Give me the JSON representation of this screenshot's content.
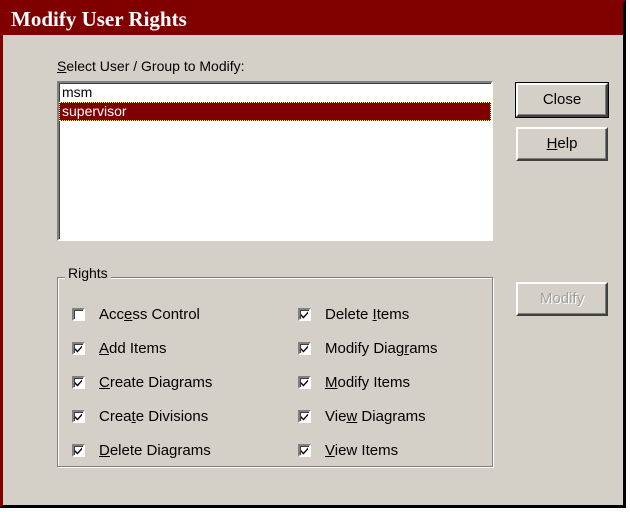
{
  "window": {
    "title": "Modify User Rights"
  },
  "select_label": {
    "pre": "",
    "mn": "S",
    "post": "elect User / Group to Modify:"
  },
  "users": [
    {
      "name": "msm",
      "selected": false
    },
    {
      "name": "supervisor",
      "selected": true
    }
  ],
  "buttons": {
    "close": {
      "pre": "Close",
      "mn": "",
      "post": ""
    },
    "help": {
      "pre": "",
      "mn": "H",
      "post": "elp"
    },
    "modify": {
      "pre": "Modify",
      "mn": "",
      "post": ""
    }
  },
  "rights": {
    "legend": "Rights",
    "left": [
      {
        "pre": "Acc",
        "mn": "e",
        "post": "ss Control",
        "checked": false
      },
      {
        "pre": "",
        "mn": "A",
        "post": "dd Items",
        "checked": true
      },
      {
        "pre": "",
        "mn": "C",
        "post": "reate Diagrams",
        "checked": true
      },
      {
        "pre": "Crea",
        "mn": "t",
        "post": "e Divisions",
        "checked": true
      },
      {
        "pre": "",
        "mn": "D",
        "post": "elete Diagrams",
        "checked": true
      }
    ],
    "right": [
      {
        "pre": "Delete ",
        "mn": "I",
        "post": "tems",
        "checked": true
      },
      {
        "pre": "Modify Diag",
        "mn": "r",
        "post": "ams",
        "checked": true
      },
      {
        "pre": "",
        "mn": "M",
        "post": "odify Items",
        "checked": true
      },
      {
        "pre": "Vie",
        "mn": "w",
        "post": " Diagrams",
        "checked": true
      },
      {
        "pre": "",
        "mn": "V",
        "post": "iew Items",
        "checked": true
      }
    ]
  }
}
